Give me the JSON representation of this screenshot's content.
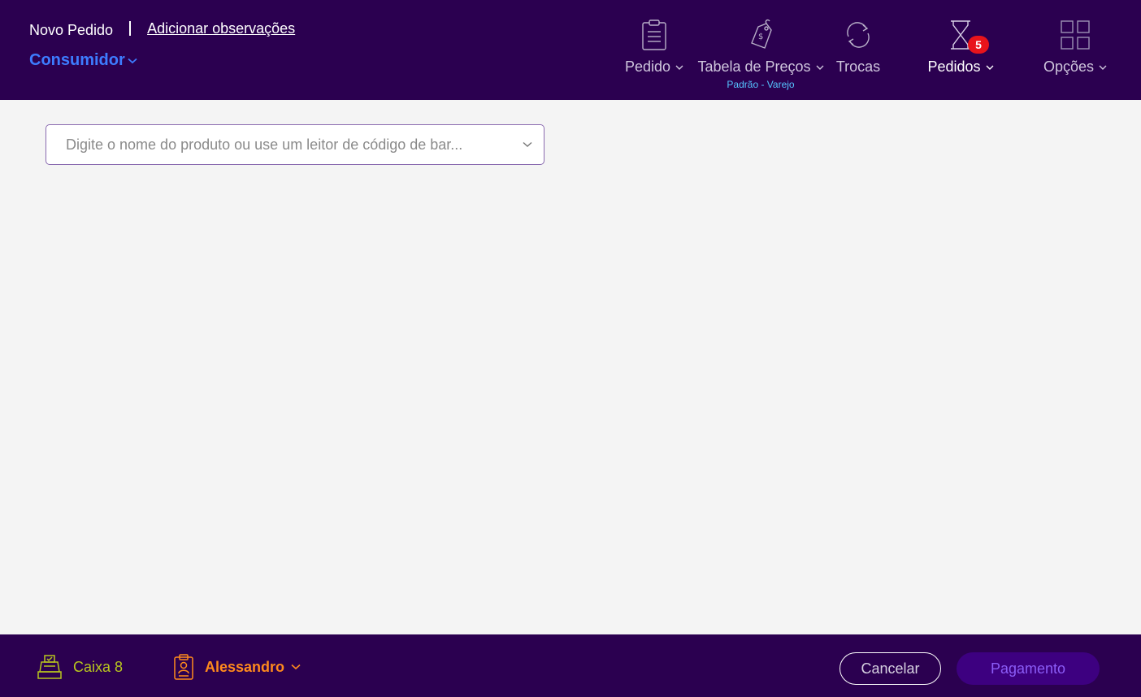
{
  "header": {
    "order_title": "Novo Pedido",
    "add_notes_link": "Adicionar observações",
    "customer": "Consumidor",
    "nav": [
      {
        "label": "Pedido",
        "icon": "clipboard-icon",
        "has_dropdown": true
      },
      {
        "label": "Tabela de Preços",
        "icon": "price-tag-icon",
        "has_dropdown": true,
        "subtitle": "Padrão - Varejo"
      },
      {
        "label": "Trocas",
        "icon": "exchange-icon",
        "has_dropdown": false
      },
      {
        "label": "Pedidos",
        "icon": "hourglass-icon",
        "has_dropdown": true,
        "badge": "5"
      },
      {
        "label": "Opções",
        "icon": "grid-icon",
        "has_dropdown": true
      }
    ]
  },
  "search": {
    "placeholder": "Digite o nome do produto ou use um leitor de código de bar..."
  },
  "footer": {
    "register_label": "Caixa 8",
    "operator_name": "Alessandro",
    "cancel_label": "Cancelar",
    "pay_label": "Pagamento"
  },
  "colors": {
    "header_bg": "#2b0050",
    "page_bg": "#f4f4f4",
    "customer_link": "#3d7cff",
    "price_table_subtitle": "#55c3ff",
    "badge": "#e8141b",
    "register": "#b8c61e",
    "operator": "#ff8a1c",
    "pay_button_bg": "#3d0080",
    "pay_button_text": "#8b5cf6"
  }
}
